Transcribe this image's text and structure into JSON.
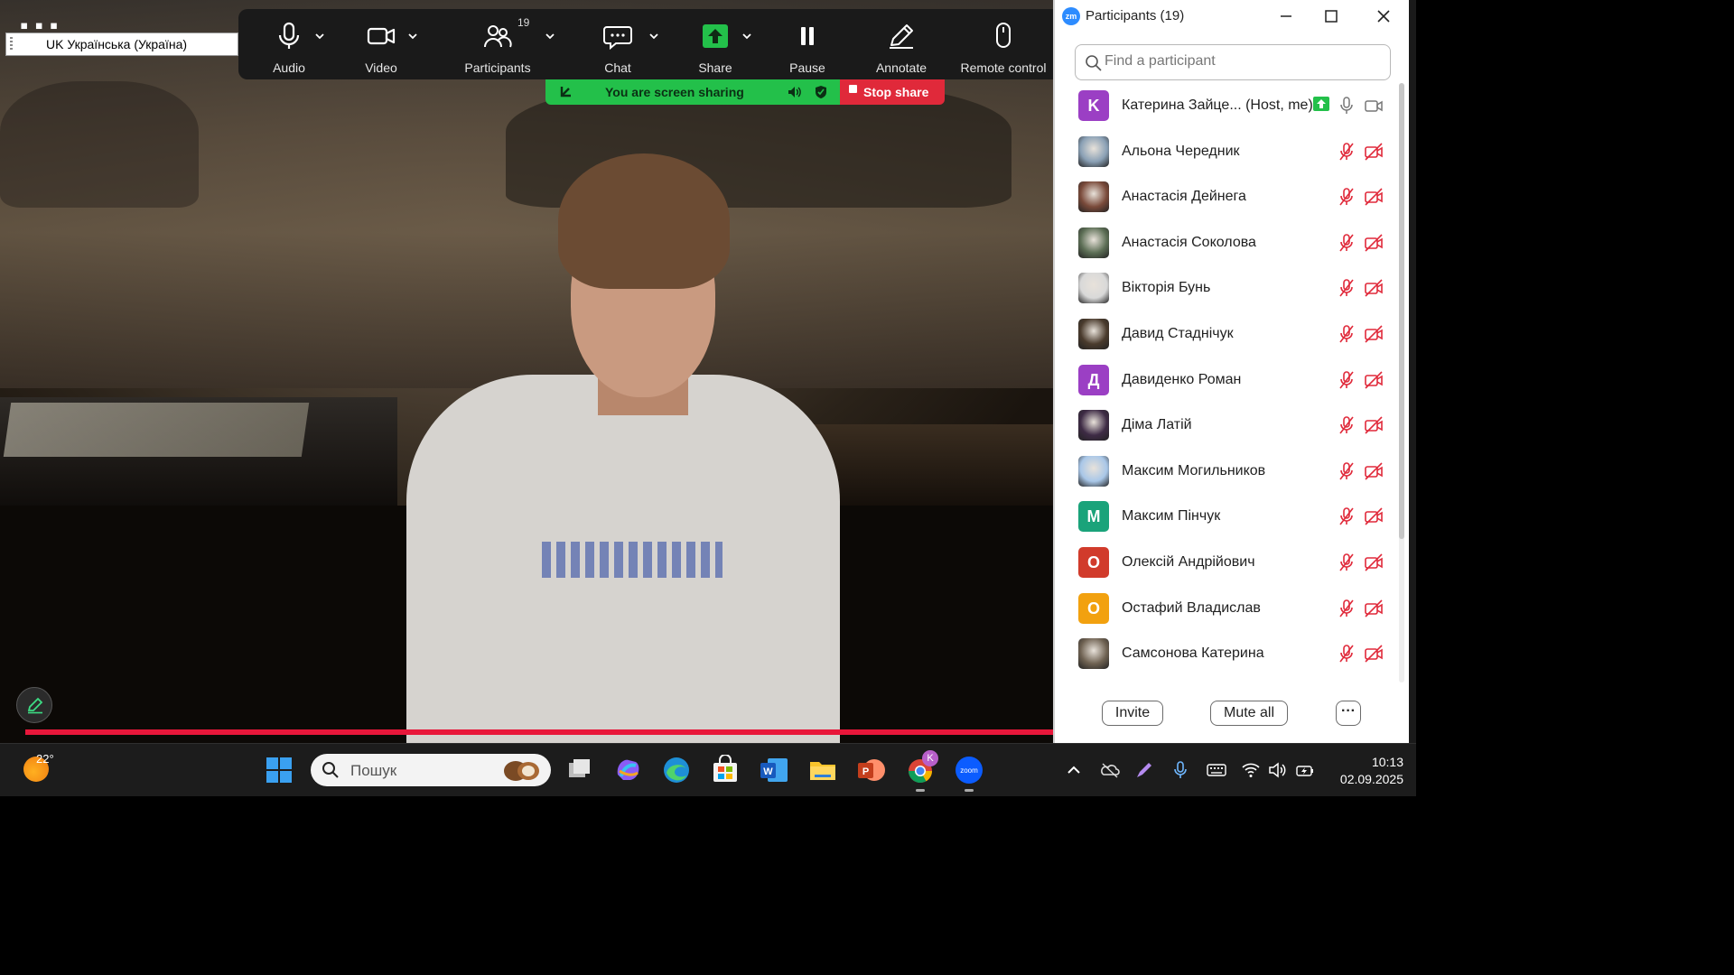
{
  "language_bar": {
    "label": "UK Українська (Україна)"
  },
  "toolbar": {
    "audio": "Audio",
    "video": "Video",
    "participants": "Participants",
    "participants_count": "19",
    "chat": "Chat",
    "share": "Share",
    "pause": "Pause",
    "annotate": "Annotate",
    "remote_control": "Remote control"
  },
  "sharing": {
    "status": "You are screen sharing",
    "stop": "Stop share"
  },
  "panel": {
    "title": "Participants (19)",
    "search_placeholder": "Find a participant",
    "participants": [
      {
        "name": "Катерина Зайце... (Host, me)",
        "initial": "K",
        "color": "#9b3fc4",
        "host": true
      },
      {
        "name": "Альона Чередник",
        "initial": "",
        "color": "#8aa0b5",
        "photo": true
      },
      {
        "name": "Анастасія Дейнега",
        "initial": "",
        "color": "#7a4a3a",
        "photo": true
      },
      {
        "name": "Анастасія Соколова",
        "initial": "",
        "color": "#5c6e55",
        "photo": true
      },
      {
        "name": "Вікторія Бунь",
        "initial": "",
        "color": "#d9d9d9",
        "photo": true
      },
      {
        "name": "Давид Стаднічук",
        "initial": "",
        "color": "#4a3b2d",
        "photo": true
      },
      {
        "name": "Давиденко Роман",
        "initial": "Д",
        "color": "#9b3fc4"
      },
      {
        "name": "Діма Латій",
        "initial": "",
        "color": "#3e2b45",
        "photo": true
      },
      {
        "name": "Максим Могильников",
        "initial": "",
        "color": "#a9c7e8",
        "photo": true
      },
      {
        "name": "Максим Пінчук",
        "initial": "M",
        "color": "#1aa37a"
      },
      {
        "name": "Олексій Андрійович",
        "initial": "O",
        "color": "#d13b2b"
      },
      {
        "name": "Остафий Владислав",
        "initial": "O",
        "color": "#f2a10f"
      },
      {
        "name": "Самсонова Катерина",
        "initial": "",
        "color": "#6f6252",
        "photo": true
      }
    ],
    "invite": "Invite",
    "mute_all": "Mute all",
    "more": "···"
  },
  "taskbar": {
    "temperature": "22°",
    "search_label": "Пошук",
    "time": "10:13",
    "date": "02.09.2025",
    "badge_letter": "K"
  },
  "colors": {
    "share_green": "#23c04a",
    "stop_red": "#e0293a",
    "muted_red": "#e0293a",
    "zoom_blue": "#2d8cff"
  }
}
